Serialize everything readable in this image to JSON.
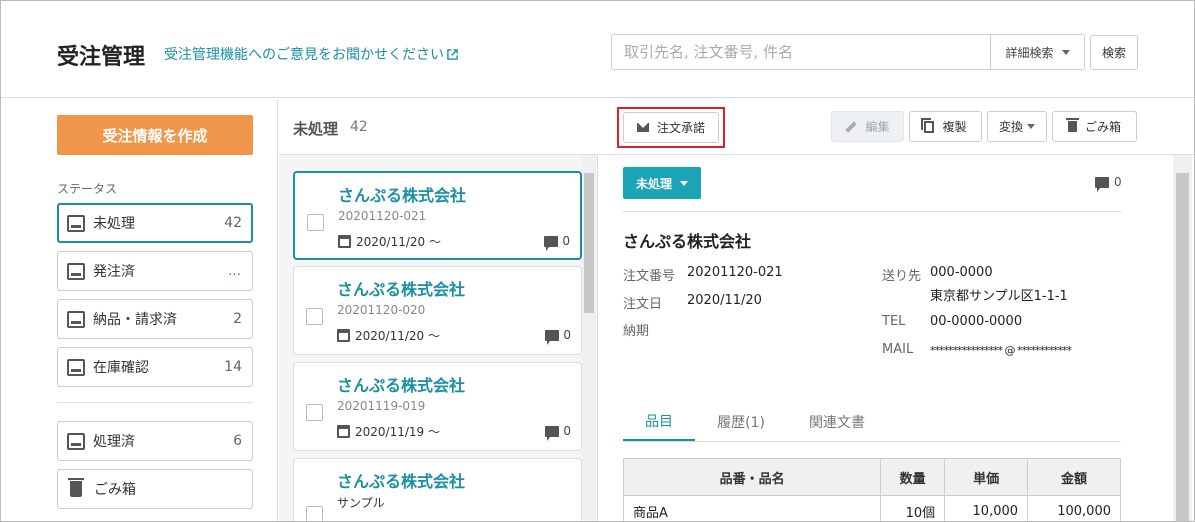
{
  "header": {
    "title": "受注管理",
    "feedback_link": "受注管理機能へのご意見をお聞かせください",
    "search_placeholder": "取引先名, 注文番号, 件名",
    "advanced_search": "詳細検索",
    "search_button": "検索"
  },
  "sidebar": {
    "create_button": "受注情報を作成",
    "status_heading": "ステータス",
    "items": [
      {
        "label": "未処理",
        "count": "42"
      },
      {
        "label": "発注済",
        "count": "…"
      },
      {
        "label": "納品・請求済",
        "count": "2"
      },
      {
        "label": "在庫確認",
        "count": "14"
      },
      {
        "label": "処理済",
        "count": "6"
      },
      {
        "label": "ごみ箱",
        "count": ""
      }
    ]
  },
  "list": {
    "title": "未処理",
    "count": "42",
    "cards": [
      {
        "company": "さんぷる株式会社",
        "number": "20201120-021",
        "date": "2020/11/20 〜",
        "comments": "0"
      },
      {
        "company": "さんぷる株式会社",
        "number": "20201120-020",
        "date": "2020/11/20 〜",
        "comments": "0"
      },
      {
        "company": "さんぷる株式会社",
        "number": "20201119-019",
        "date": "2020/11/19 〜",
        "comments": "0"
      },
      {
        "company": "さんぷる株式会社",
        "number": "サンプル",
        "date": "",
        "comments": ""
      }
    ]
  },
  "toolbar": {
    "approve": "注文承諾",
    "edit": "編集",
    "copy": "複製",
    "convert": "変換",
    "trash": "ごみ箱"
  },
  "detail": {
    "status": "未処理",
    "comments": "0",
    "company": "さんぷる株式会社",
    "order_no_label": "注文番号",
    "order_no": "20201120-021",
    "order_date_label": "注文日",
    "order_date": "2020/11/20",
    "due_label": "納期",
    "ship_label": "送り先",
    "postal": "000-0000",
    "address": "東京都サンプル区1-1-1",
    "tel_label": "TEL",
    "tel": "00-0000-0000",
    "mail_label": "MAIL",
    "mail": "**************** @ ************"
  },
  "tabs": [
    "品目",
    "履歴(1)",
    "関連文書"
  ],
  "table": {
    "headers": [
      "品番・品名",
      "数量",
      "単価",
      "金額"
    ],
    "rows": [
      [
        "商品A",
        "10個",
        "10,000",
        "100,000"
      ]
    ]
  },
  "colors": {
    "accent": "#1a8fa6",
    "create_button": "#f0964a",
    "highlight": "#e02020",
    "status_chip": "#1ba3b8"
  }
}
